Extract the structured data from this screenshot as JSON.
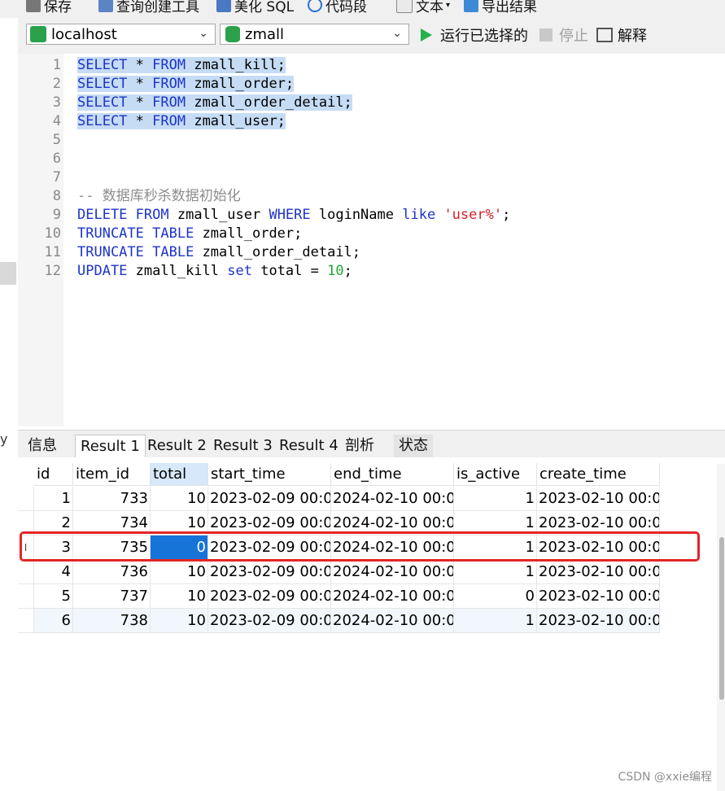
{
  "toolbar": {
    "save_label": "保存",
    "query_builder_label": "查询创建工具",
    "beautify_label": "美化 SQL",
    "snippet_label": "代码段",
    "text_label": "文本",
    "export_label": "导出结果"
  },
  "connection": {
    "host": "localhost",
    "database": "zmall",
    "run_selected_label": "运行已选择的",
    "stop_label": "停止",
    "explain_label": "解释"
  },
  "editor": {
    "lines": [
      {
        "n": "1",
        "text": "SELECT * FROM zmall_kill;"
      },
      {
        "n": "2",
        "text": "SELECT * FROM zmall_order;"
      },
      {
        "n": "3",
        "text": "SELECT * FROM zmall_order_detail;"
      },
      {
        "n": "4",
        "text": "SELECT * FROM zmall_user;"
      },
      {
        "n": "5",
        "text": ""
      },
      {
        "n": "6",
        "text": ""
      },
      {
        "n": "7",
        "text": ""
      },
      {
        "n": "8",
        "text": "-- 数据库秒杀数据初始化"
      },
      {
        "n": "9",
        "text": "DELETE FROM zmall_user WHERE loginName like 'user%';"
      },
      {
        "n": "10",
        "text": "TRUNCATE TABLE zmall_order;"
      },
      {
        "n": "11",
        "text": "TRUNCATE TABLE zmall_order_detail;"
      },
      {
        "n": "12",
        "text": "UPDATE zmall_kill set total = 10;"
      }
    ]
  },
  "side": {
    "edge_char": "y"
  },
  "tabs": [
    "信息",
    "Result 1",
    "Result 2",
    "Result 3",
    "Result 4",
    "剖析",
    "状态"
  ],
  "grid": {
    "columns": [
      "id",
      "item_id",
      "total",
      "start_time",
      "end_time",
      "is_active",
      "create_time"
    ],
    "rows": [
      [
        "1",
        "733",
        "10",
        "2023-02-09 00:0",
        "2024-02-10 00:0",
        "1",
        "2023-02-10 00:0"
      ],
      [
        "2",
        "734",
        "10",
        "2023-02-09 00:0",
        "2024-02-10 00:0",
        "1",
        "2023-02-10 00:0"
      ],
      [
        "3",
        "735",
        "0",
        "2023-02-09 00:0",
        "2024-02-10 00:0",
        "1",
        "2023-02-10 00:0"
      ],
      [
        "4",
        "736",
        "10",
        "2023-02-09 00:0",
        "2024-02-10 00:0",
        "1",
        "2023-02-10 00:0"
      ],
      [
        "5",
        "737",
        "10",
        "2023-02-09 00:0",
        "2024-02-10 00:0",
        "0",
        "2023-02-10 00:0"
      ],
      [
        "6",
        "738",
        "10",
        "2023-02-09 00:0",
        "2024-02-10 00:0",
        "1",
        "2023-02-10 00:0"
      ]
    ],
    "current_row_marker": "I"
  },
  "watermark": "CSDN @xxie编程",
  "colors": {
    "keyword": "#1e34c8",
    "string": "#d2202a",
    "number": "#1fa631",
    "comment": "#8c8c8c",
    "selection": "#c6dcf5",
    "selected_cell": "#1673d8",
    "annotation_box": "#e32626",
    "run_icon": "#27b14a"
  }
}
